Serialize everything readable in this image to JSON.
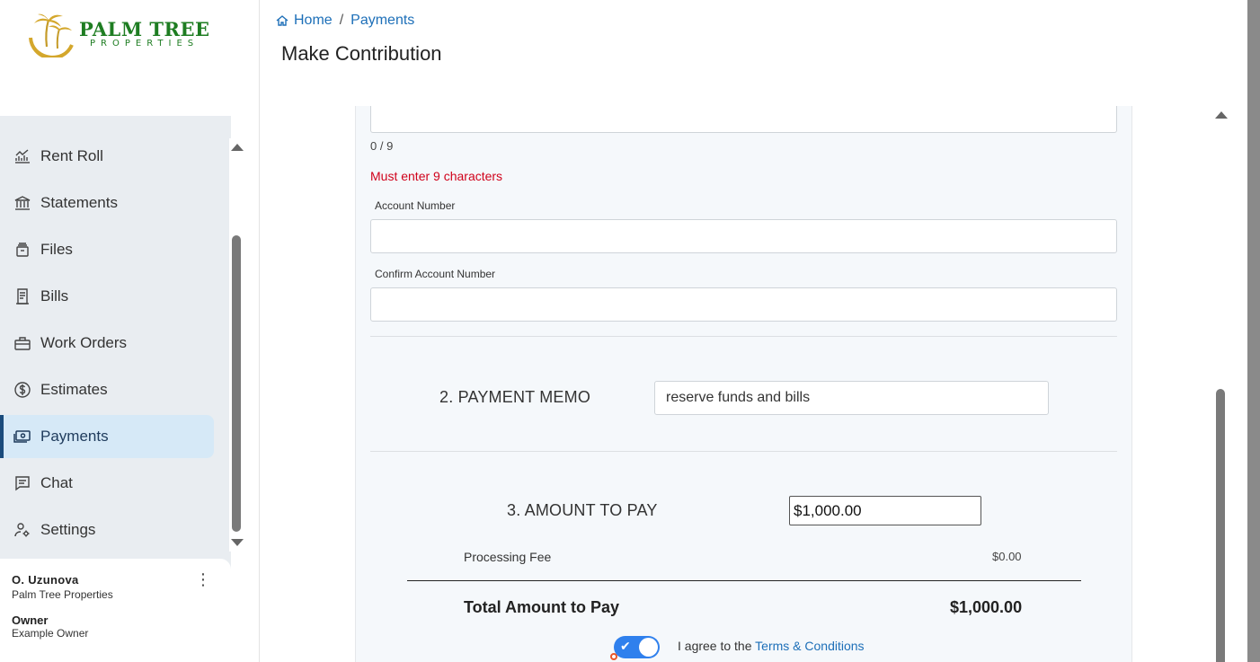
{
  "brand": {
    "name": "PALM TREE",
    "sub": "PROPERTIES"
  },
  "nav": {
    "items": [
      {
        "label": "Rent Roll",
        "icon": "chart-line-icon"
      },
      {
        "label": "Statements",
        "icon": "bank-icon"
      },
      {
        "label": "Files",
        "icon": "files-icon"
      },
      {
        "label": "Bills",
        "icon": "receipt-icon"
      },
      {
        "label": "Work Orders",
        "icon": "toolbox-icon"
      },
      {
        "label": "Estimates",
        "icon": "dollar-circle-icon"
      },
      {
        "label": "Payments",
        "icon": "money-icon",
        "active": true
      },
      {
        "label": "Chat",
        "icon": "chat-icon"
      },
      {
        "label": "Settings",
        "icon": "user-settings-icon"
      }
    ]
  },
  "user": {
    "name": "O. Uzunova",
    "org": "Palm Tree Properties",
    "role": "Owner",
    "role_sub": "Example Owner"
  },
  "breadcrumb": {
    "home": "Home",
    "separator": "/",
    "current": "Payments"
  },
  "page_title": "Make Contribution",
  "form": {
    "counter": "0 / 9",
    "error": "Must enter 9 characters",
    "account_label": "Account Number",
    "account_value": "",
    "confirm_label": "Confirm Account Number",
    "confirm_value": "",
    "memo_section": "2. PAYMENT MEMO",
    "memo_value": "reserve funds and bills",
    "amount_section": "3. AMOUNT TO PAY",
    "amount_value": "$1,000.00",
    "fee_label": "Processing Fee",
    "fee_value": "$0.00",
    "total_label": "Total Amount to Pay",
    "total_value": "$1,000.00",
    "agree_text": "I agree to the",
    "terms_link": "Terms & Conditions",
    "agree_checked": true
  },
  "colors": {
    "accent": "#1d6fb8",
    "active_nav_bg": "#d6e9f7",
    "error": "#d0021b",
    "toggle": "#2f80ed",
    "brand_green": "#1e7d22",
    "brand_gold": "#d4a72c"
  }
}
